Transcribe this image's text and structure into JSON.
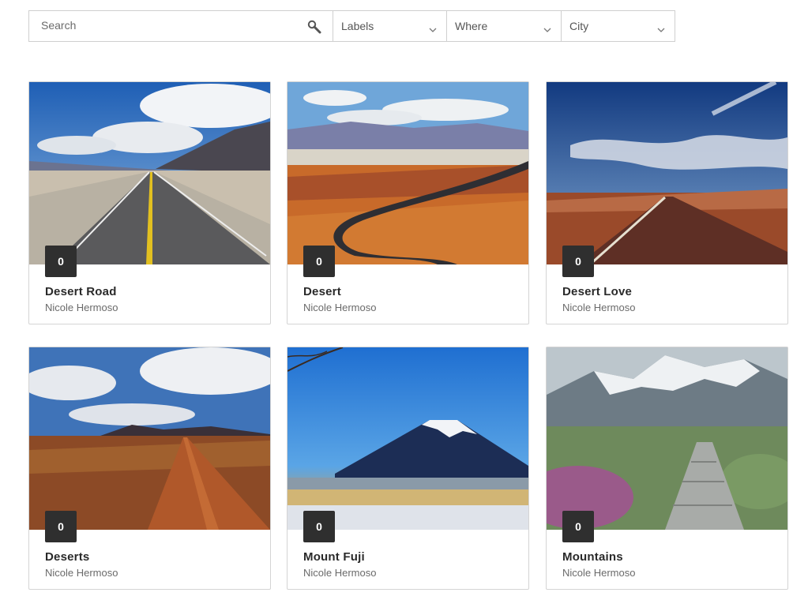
{
  "filters": {
    "search_placeholder": "Search",
    "labels": "Labels",
    "where": "Where",
    "city": "City"
  },
  "cards": [
    {
      "title": "Desert Road",
      "author": "Nicole Hermoso",
      "count": "0",
      "image": "desert-road-photo"
    },
    {
      "title": "Desert",
      "author": "Nicole Hermoso",
      "count": "0",
      "image": "winding-desert-road-photo"
    },
    {
      "title": "Desert Love",
      "author": "Nicole Hermoso",
      "count": "0",
      "image": "red-desert-road-photo"
    },
    {
      "title": "Deserts",
      "author": "Nicole Hermoso",
      "count": "0",
      "image": "dirt-road-desert-photo"
    },
    {
      "title": "Mount Fuji",
      "author": "Nicole Hermoso",
      "count": "0",
      "image": "mount-fuji-photo"
    },
    {
      "title": "Mountains",
      "author": "Nicole Hermoso",
      "count": "0",
      "image": "mountain-stone-path-photo"
    }
  ]
}
